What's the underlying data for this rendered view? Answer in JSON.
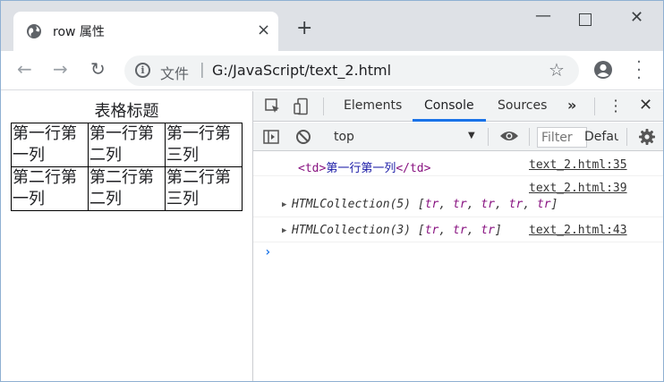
{
  "tab": {
    "title": "row 属性",
    "close": "×"
  },
  "new_tab": "+",
  "window_controls": {
    "minimize": "—",
    "close": "✕"
  },
  "nav": {
    "back": "←",
    "forward": "→",
    "reload": "↻"
  },
  "omnibox": {
    "label": "文件",
    "separator": "|",
    "url": "G:/JavaScript/text_2.html"
  },
  "page": {
    "caption": "表格标题",
    "rows": [
      [
        "第一行第一列",
        "第一行第二列",
        "第一行第三列"
      ],
      [
        "第二行第一列",
        "第二行第二列",
        "第二行第三列"
      ]
    ]
  },
  "devtools": {
    "tabs": [
      "Elements",
      "Console",
      "Sources"
    ],
    "active_tab": "Console",
    "more": "»",
    "context": "top",
    "filter_placeholder": "Filter",
    "level": "Default levels",
    "messages": [
      {
        "open_tag": "<td>",
        "content": "第一行第一列",
        "close_tag": "</td>",
        "source": "text_2.html:35"
      },
      {
        "source": "text_2.html:39",
        "prefix": "HTMLCollection(5) [",
        "items": [
          "tr",
          "tr",
          "tr",
          "tr",
          "tr"
        ],
        "suffix": "]"
      },
      {
        "source": "text_2.html:43",
        "prefix": "HTMLCollection(3) [",
        "items": [
          "tr",
          "tr",
          "tr"
        ],
        "suffix": "]"
      }
    ],
    "prompt": "›"
  },
  "colors": {
    "accent": "#1a73e8",
    "tag": "#881280",
    "chrome_bg": "#dee1e6"
  }
}
